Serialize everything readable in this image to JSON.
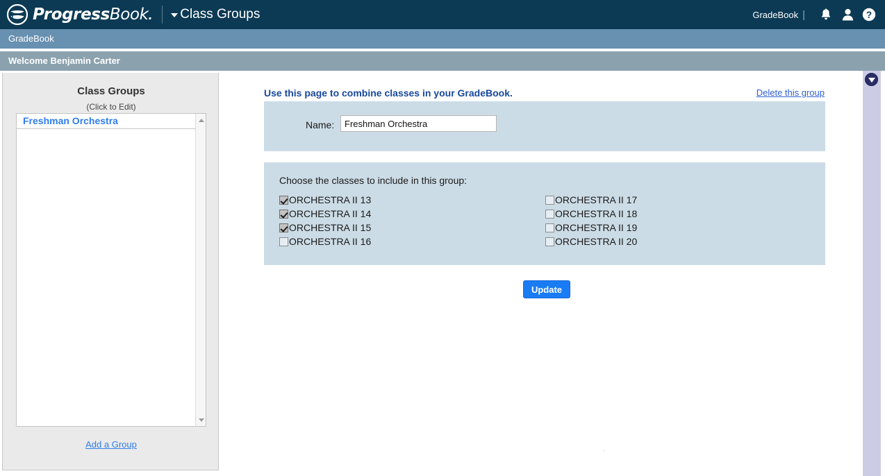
{
  "topbar": {
    "brand_primary": "Progress",
    "brand_secondary": "Book",
    "brand_dot": ".",
    "page_menu_label": "Class Groups",
    "user_label": "GradeBook",
    "separator": "|",
    "icons": {
      "bell": "bell-icon",
      "user": "user-icon",
      "help": "help-icon"
    }
  },
  "module_bar": {
    "label": "GradeBook"
  },
  "welcome_bar": {
    "label": "Welcome Benjamin Carter"
  },
  "sidebar": {
    "title": "Class Groups",
    "subtitle": "(Click to Edit)",
    "groups": [
      {
        "label": "Freshman Orchestra"
      }
    ],
    "add_link": "Add a Group"
  },
  "main": {
    "headline": "Use this page to combine classes in your GradeBook.",
    "delete_link": "Delete this group",
    "name_label": "Name:",
    "name_value": "Freshman Orchestra",
    "name_placeholder": "",
    "choose_label": "Choose the classes to include in this group:",
    "classes_left": [
      {
        "label": "ORCHESTRA II 13",
        "checked": true
      },
      {
        "label": "ORCHESTRA II 14",
        "checked": true
      },
      {
        "label": "ORCHESTRA II 15",
        "checked": true
      },
      {
        "label": "ORCHESTRA II 16",
        "checked": false
      }
    ],
    "classes_right": [
      {
        "label": "ORCHESTRA II 17",
        "checked": false
      },
      {
        "label": "ORCHESTRA II 18",
        "checked": false
      },
      {
        "label": "ORCHESTRA II 19",
        "checked": false
      },
      {
        "label": "ORCHESTRA II 20",
        "checked": false
      }
    ],
    "update_button": "Update",
    "footer_mark": "."
  },
  "right_rail": {
    "collapse_icon": "chevron-down-circle-icon"
  },
  "colors": {
    "topbar_bg": "#0c3a54",
    "module_bar_bg": "#6890b0",
    "welcome_bar_bg": "#8ba2ae",
    "sidebar_bg": "#eaeaea",
    "panel_bg": "#ccdce6",
    "accent_link": "#2f7ded",
    "headline": "#17489b",
    "button_bg": "#1a7cf5",
    "rail_bg": "#cccde5"
  }
}
